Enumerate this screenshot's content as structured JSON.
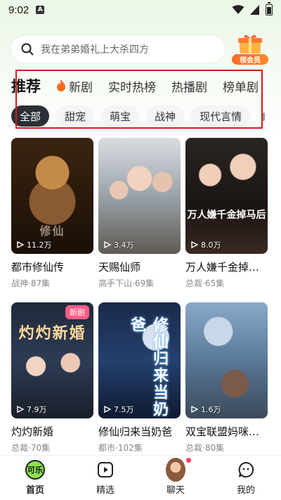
{
  "status_bar": {
    "time": "9:02",
    "notif_glyph": "A"
  },
  "search": {
    "placeholder": "我在弟弟婚礼上大杀四方"
  },
  "vip": {
    "label": "领会员"
  },
  "category_tabs": [
    {
      "label": "推荐",
      "active": true
    },
    {
      "label": "新剧",
      "icon": "fire-icon"
    },
    {
      "label": "实时热榜"
    },
    {
      "label": "热播剧"
    },
    {
      "label": "榜单剧"
    }
  ],
  "filter_chips": [
    {
      "label": "全部",
      "active": true
    },
    {
      "label": "甜宠"
    },
    {
      "label": "萌宝"
    },
    {
      "label": "战神"
    },
    {
      "label": "现代言情"
    }
  ],
  "dramas": [
    {
      "title": "都市修仙传",
      "meta": "战神·87集",
      "views": "11.2万",
      "poster_text": "修仙"
    },
    {
      "title": "天赐仙师",
      "meta": "高手下山·69集",
      "views": "3.4万",
      "poster_text": ""
    },
    {
      "title": "万人嫌千金掉马...",
      "meta": "总裁·65集",
      "views": "8.0万",
      "poster_text": "万人嫌千金掉马后"
    },
    {
      "title": "灼灼新婚",
      "meta": "总裁·70集",
      "views": "7.9万",
      "poster_text": "灼灼新婚",
      "badge": "新剧"
    },
    {
      "title": "修仙归来当奶爸",
      "meta": "都市·102集",
      "views": "7.5万",
      "poster_text": "修仙归来当奶爸"
    },
    {
      "title": "双宝联盟妈咪火...",
      "meta": "总裁·80集",
      "views": "1.6万",
      "poster_text": ""
    }
  ],
  "bottom_nav": [
    {
      "label": "首页",
      "active": true,
      "icon_text": "可乐"
    },
    {
      "label": "精选"
    },
    {
      "label": "聊天"
    },
    {
      "label": "我的"
    }
  ],
  "colors": {
    "highlight": "#d51c1c",
    "accent_green": "#8be34a",
    "badge_pink": "#ff5d86",
    "vip_orange": "#ff6a2d"
  }
}
